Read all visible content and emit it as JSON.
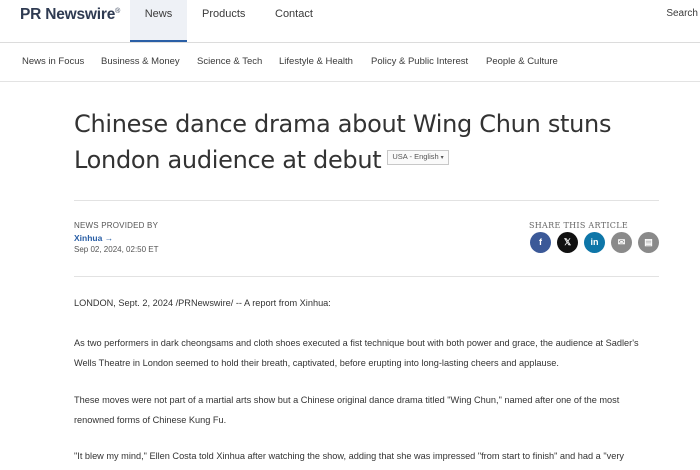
{
  "header": {
    "logo_text": "PR Newswire",
    "logo_mark": "®",
    "nav": [
      {
        "label": "News",
        "active": true
      },
      {
        "label": "Products",
        "active": false
      },
      {
        "label": "Contact",
        "active": false
      }
    ],
    "search_label": "Search"
  },
  "categories": [
    "News in Focus",
    "Business & Money",
    "Science & Tech",
    "Lifestyle & Health",
    "Policy & Public Interest",
    "People & Culture"
  ],
  "article": {
    "title": "Chinese dance drama about Wing Chun stuns London audience at debut",
    "language_select": "USA - English",
    "provided_by_label": "NEWS PROVIDED BY",
    "provider": "Xinhua",
    "provider_arrow": "→",
    "date": "Sep 02, 2024, 02:50 ET",
    "share_label": "SHARE THIS ARTICLE",
    "share_icons": [
      {
        "name": "facebook-icon",
        "glyph": "f",
        "color": "#3b5998"
      },
      {
        "name": "x-icon",
        "glyph": "𝕏",
        "color": "#111111"
      },
      {
        "name": "linkedin-icon",
        "glyph": "in",
        "color": "#0e76a8"
      },
      {
        "name": "email-icon",
        "glyph": "✉",
        "color": "#8a8a8a"
      },
      {
        "name": "print-icon",
        "glyph": "▤",
        "color": "#8a8a8a"
      }
    ],
    "paragraphs": [
      "LONDON, Sept. 2, 2024 /PRNewswire/ -- A report from Xinhua:",
      "As two performers in dark cheongsams and cloth shoes executed a fist technique bout with both power and grace, the audience at Sadler's Wells Theatre in London seemed to hold their breath, captivated, before erupting into long-lasting cheers and applause.",
      "These moves were not part of a martial arts show but a Chinese original dance drama titled \"Wing Chun,\" named after one of the most renowned forms of Chinese Kung Fu.",
      "\"It blew my mind,\" Ellen Costa told Xinhua after watching the show, adding that she was impressed \"from start to finish\" and had a \"very"
    ]
  }
}
